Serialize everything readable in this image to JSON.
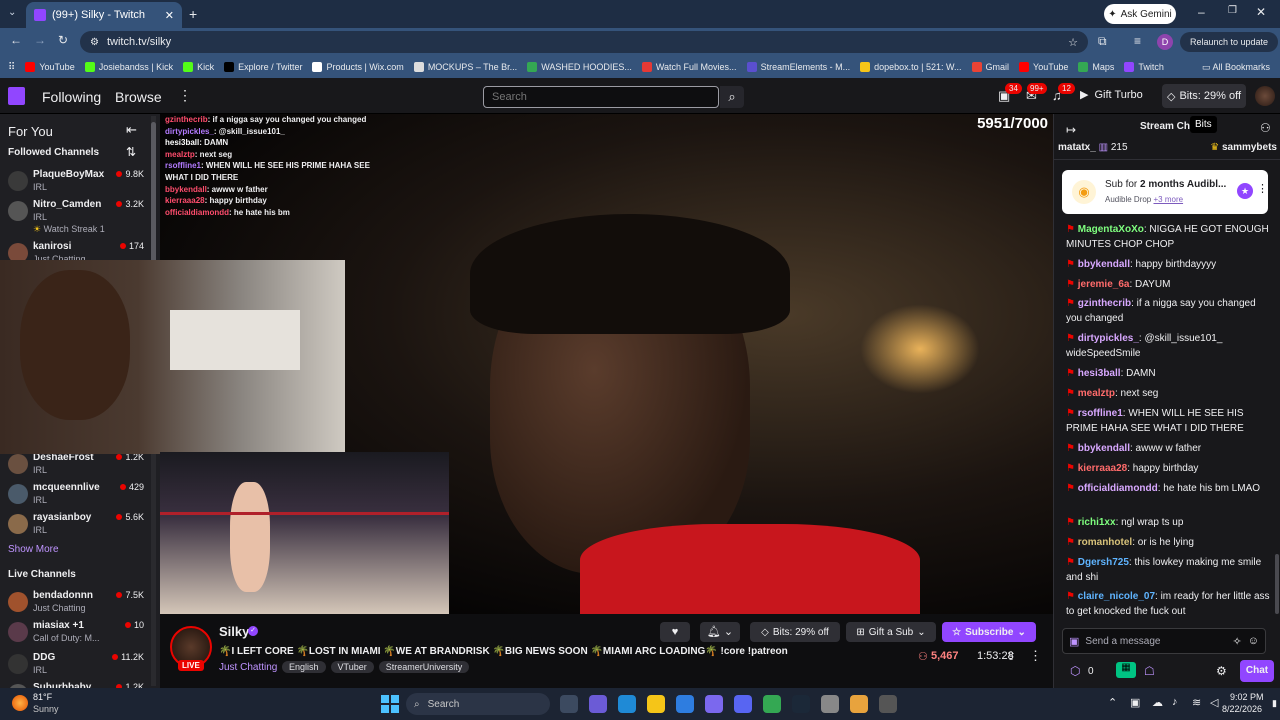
{
  "browser": {
    "tab_title": "(99+) Silky - Twitch",
    "url": "twitch.tv/silky",
    "ask_gemini": "Ask Gemini",
    "relaunch": "Relaunch to update",
    "profile_letter": "D",
    "bookmarks": [
      {
        "label": "YouTube",
        "color": "#ff0000"
      },
      {
        "label": "Josiebandss | Kick",
        "color": "#53fc18"
      },
      {
        "label": "Kick",
        "color": "#53fc18"
      },
      {
        "label": "Explore / Twitter",
        "color": "#000000"
      },
      {
        "label": "Products | Wix.com",
        "color": "#ffffff"
      },
      {
        "label": "MOCKUPS – The Br...",
        "color": "#dddddd"
      },
      {
        "label": "WASHED HOODIES...",
        "color": "#34a853"
      },
      {
        "label": "Watch Full Movies...",
        "color": "#e53935"
      },
      {
        "label": "StreamElements - M...",
        "color": "#5a4fcf"
      },
      {
        "label": "dopebox.to | 521: W...",
        "color": "#f5c518"
      },
      {
        "label": "Gmail",
        "color": "#ea4335"
      },
      {
        "label": "YouTube",
        "color": "#ff0000"
      },
      {
        "label": "Maps",
        "color": "#34a853"
      },
      {
        "label": "Twitch",
        "color": "#9146ff"
      }
    ],
    "all_bookmarks": "All Bookmarks"
  },
  "topnav": {
    "following": "Following",
    "browse": "Browse",
    "search_placeholder": "Search",
    "badge_1": "34",
    "badge_2": "99+",
    "badge_3": "12",
    "gift_turbo": "Gift Turbo",
    "bits_offer": "Bits: 29% off",
    "tooltip": "Bits"
  },
  "sidebar": {
    "for_you": "For You",
    "followed_channels": "Followed Channels",
    "show_more": "Show More",
    "live_channels": "Live Channels",
    "followed": [
      {
        "name": "PlaqueBoyMax",
        "game": "IRL",
        "viewers": "9.8K",
        "color": "#3a3a3a"
      },
      {
        "name": "Nitro_Camden",
        "game": "IRL",
        "viewers": "3.2K",
        "sub": "Watch Streak 1",
        "color": "#555"
      },
      {
        "name": "kanirosi",
        "game": "Just Chatting",
        "viewers": "174",
        "color": "#7a4a3a"
      },
      {
        "name": "DeshaeFrost",
        "game": "IRL",
        "viewers": "1.2K",
        "color": "#6a5040"
      },
      {
        "name": "mcqueennlive",
        "game": "IRL",
        "viewers": "429",
        "color": "#4a5a6a"
      },
      {
        "name": "rayasianboy",
        "game": "IRL",
        "viewers": "5.6K",
        "color": "#8a6a4a"
      }
    ],
    "live": [
      {
        "name": "bendadonnn",
        "game": "Just Chatting",
        "viewers": "7.5K",
        "color": "#a0522d"
      },
      {
        "name": "miasiax +1",
        "game": "Call of Duty: M...",
        "viewers": "10",
        "color": "#5a3a4a"
      },
      {
        "name": "DDG",
        "game": "IRL",
        "viewers": "11.2K",
        "color": "#333"
      },
      {
        "name": "Suburbbaby",
        "game": "",
        "viewers": "1.2K",
        "color": "#555"
      }
    ]
  },
  "video": {
    "goal_counter": "5951/7000",
    "overlay_chat": [
      {
        "user": "gzinthecrib",
        "text": ": if a nigga say you changed you changed",
        "color": "#ff4d6d"
      },
      {
        "user": "dirtypickles_",
        "text": ": @skill_issue101_",
        "color": "#b37bff"
      },
      {
        "user": "hesi3ball",
        "text": ": DAMN",
        "color": "#ffffff"
      },
      {
        "user": "mealztp",
        "text": ": next seg",
        "color": "#ff4d6d"
      },
      {
        "user": "rsoffline1",
        "text": ": WHEN WILL HE SEE HIS PRIME HAHA SEE",
        "color": "#b37bff"
      },
      {
        "user": "",
        "text": "WHAT I DID THERE",
        "color": "#ffffff"
      },
      {
        "user": "bbykendall",
        "text": ": awww w father",
        "color": "#ff4d6d"
      },
      {
        "user": "kierraaa28",
        "text": ": happy birthday",
        "color": "#ff4d6d"
      },
      {
        "user": "officialdiamondd",
        "text": ": he hate his bm",
        "color": "#ff4d6d"
      }
    ]
  },
  "stream_info": {
    "channel": "Silky",
    "live_label": "LIVE",
    "title": "🌴I LEFT CORE 🌴LOST IN MIAMI 🌴WE AT BRANDRISK 🌴BIG NEWS SOON 🌴MIAMI ARC LOADING🌴 !core !patreon",
    "category": "Just Chatting",
    "tags": [
      "English",
      "VTuber",
      "StreamerUniversity"
    ],
    "bits_btn": "Bits: 29% off",
    "gift_sub": "Gift a Sub",
    "subscribe": "Subscribe",
    "viewers": "5,467",
    "uptime": "1:53:28"
  },
  "chat": {
    "header": "Stream Chat",
    "pinned_left_user": "matatx_",
    "pinned_left_count": "215",
    "pinned_right_user": "sammybets",
    "drop_title_prefix": "Sub for ",
    "drop_title_bold": "2 months Audibl...",
    "drop_sub": "Audible Drop",
    "drop_more": "+3 more",
    "messages": [
      {
        "user": "MagentaXoXo",
        "color": "#7fff7f",
        "text": ": NIGGA HE GOT ENOUGH MINUTES CHOP CHOP"
      },
      {
        "user": "bbykendall",
        "color": "#d8a8ff",
        "text": ": happy birthdayyyy"
      },
      {
        "user": "jeremie_6a",
        "color": "#ff6b6b",
        "text": ": DAYUM"
      },
      {
        "user": "gzinthecrib",
        "color": "#d8a8ff",
        "text": ": if a nigga say you changed you changed"
      },
      {
        "user": "dirtypickles_",
        "color": "#d8a8ff",
        "text": ": @skill_issue101_ wideSpeedSmile"
      },
      {
        "user": "hesi3ball",
        "color": "#d8a8ff",
        "text": ": DAMN"
      },
      {
        "user": "mealztp",
        "color": "#ff6b6b",
        "text": ": next seg"
      },
      {
        "user": "rsoffline1",
        "color": "#d8a8ff",
        "text": ": WHEN WILL HE SEE HIS PRIME HAHA SEE WHAT I DID THERE"
      },
      {
        "user": "bbykendall",
        "color": "#d8a8ff",
        "text": ": awww w father"
      },
      {
        "user": "kierraaa28",
        "color": "#ff6b6b",
        "text": ": happy birthday"
      },
      {
        "user": "officialdiamondd",
        "color": "#d8a8ff",
        "text": ": he hate his bm LMAO"
      },
      {
        "user": "richi1xx",
        "color": "#7fff7f",
        "text": ": ngl wrap ts up"
      },
      {
        "user": "romanhotel",
        "color": "#d8c27a",
        "text": ": or is he lying"
      },
      {
        "user": "Dgersh725",
        "color": "#5fb4ff",
        "text": ": this lowkey making me smile and shi"
      },
      {
        "user": "claire_nicole_07",
        "color": "#5fb4ff",
        "text": ": im ready for her little ass to get knocked the fuck out"
      }
    ],
    "input_placeholder": "Send a message",
    "points": "0",
    "chat_btn": "Chat"
  },
  "taskbar": {
    "weather_temp": "81°F",
    "weather_desc": "Sunny",
    "search_placeholder": "Search",
    "time": "9:02 PM",
    "date": "8/22/2026"
  }
}
